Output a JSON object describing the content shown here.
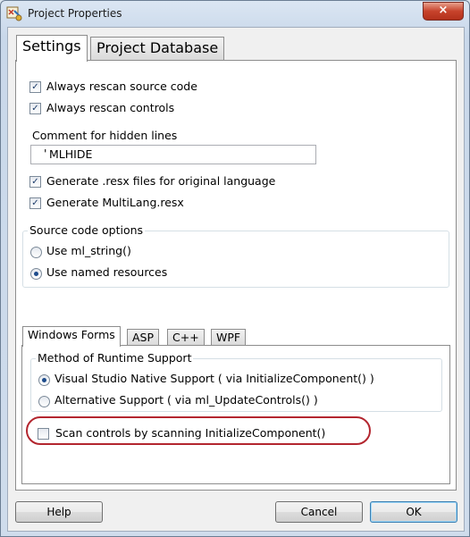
{
  "window": {
    "title": "Project Properties",
    "close_glyph": "×"
  },
  "outer_tabs": [
    {
      "label": "Settings"
    },
    {
      "label": "Project Database"
    }
  ],
  "settings": {
    "always_rescan_source": {
      "label": "Always rescan source code",
      "checked": true
    },
    "always_rescan_controls": {
      "label": "Always rescan controls",
      "checked": true
    },
    "comment_label": "Comment for hidden lines",
    "comment_prefix": "'",
    "comment_value": "MLHIDE",
    "generate_resx": {
      "label": "Generate .resx files for original language",
      "checked": true
    },
    "generate_multilang": {
      "label": "Generate MultiLang.resx",
      "checked": true
    },
    "source_options": {
      "title": "Source code options",
      "options": [
        {
          "label": "Use ml_string()",
          "selected": false
        },
        {
          "label": "Use named resources",
          "selected": true
        }
      ]
    }
  },
  "inner_tabs": [
    {
      "label": "Windows Forms"
    },
    {
      "label": "ASP"
    },
    {
      "label": "C++"
    },
    {
      "label": "WPF"
    }
  ],
  "windows_forms": {
    "method_title": "Method of Runtime Support",
    "options": [
      {
        "label": "Visual Studio Native Support ( via InitializeComponent() )",
        "selected": true
      },
      {
        "label": "Alternative Support ( via ml_UpdateControls() )",
        "selected": false
      }
    ],
    "scan_controls": {
      "label": "Scan controls by scanning InitializeComponent()",
      "checked": false
    }
  },
  "buttons": {
    "help": "Help",
    "cancel": "Cancel",
    "ok": "OK"
  },
  "colors": {
    "highlight": "#b3262f",
    "title_bar": "#dbe6f3",
    "close_button": "#c7432c"
  }
}
